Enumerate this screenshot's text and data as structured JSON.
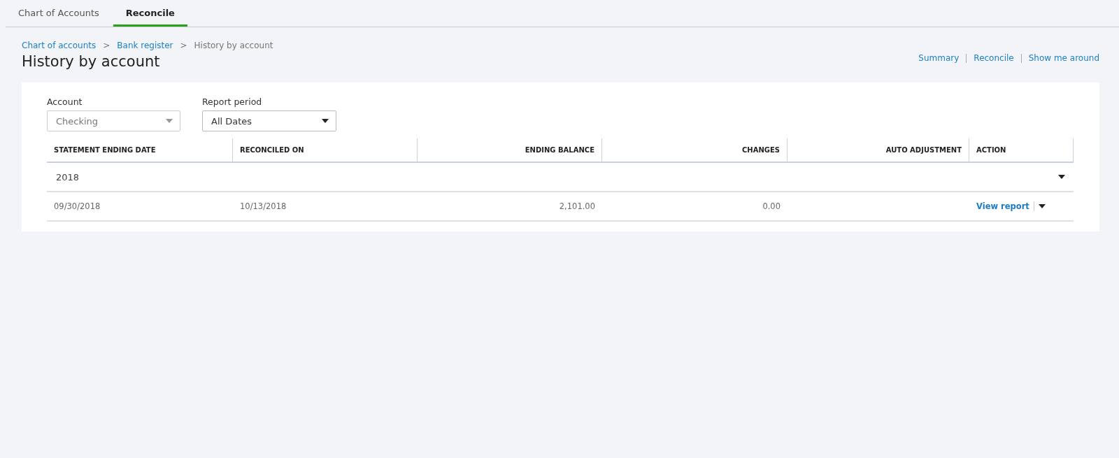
{
  "tabs": [
    {
      "label": "Chart of Accounts",
      "selected": false
    },
    {
      "label": "Reconcile",
      "selected": true
    }
  ],
  "breadcrumb": [
    {
      "label": "Chart of accounts",
      "kind": "link"
    },
    {
      "label": ">",
      "kind": "separator"
    },
    {
      "label": "Bank register",
      "kind": "link"
    },
    {
      "label": ">",
      "kind": "separator"
    },
    {
      "label": "History by account",
      "kind": "current"
    }
  ],
  "page_title": "History by account",
  "header_links": [
    "Summary",
    "Reconcile",
    "Show me around"
  ],
  "filters": [
    {
      "label": "Account",
      "value": "Checking",
      "disabled": true
    },
    {
      "label": "Report period",
      "value": "All Dates",
      "disabled": false
    }
  ],
  "table": {
    "columns": [
      {
        "label": "STATEMENT ENDING DATE"
      },
      {
        "label": "RECONCILED ON"
      },
      {
        "label": "ENDING BALANCE"
      },
      {
        "label": "CHANGES"
      },
      {
        "label": "AUTO ADJUSTMENT"
      },
      {
        "label": "ACTION"
      }
    ],
    "groups": [
      {
        "label": "2018",
        "expanded": true,
        "rows": [
          {
            "cells": [
              "09/30/2018",
              "10/13/2018",
              "2,101.00",
              "0.00",
              ""
            ],
            "action": "View report"
          }
        ]
      }
    ]
  }
}
